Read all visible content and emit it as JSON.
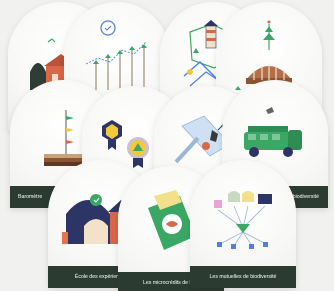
{
  "cards": {
    "row1_a": {
      "label": ""
    },
    "row1_b": {
      "label": ""
    },
    "row1_c": {
      "label": ""
    },
    "row1_d": {
      "label": ""
    },
    "row2_a": {
      "label": "Baromètre"
    },
    "row2_b": {
      "label": ""
    },
    "row2_c": {
      "label": ""
    },
    "row2_d": {
      "label": "biodiversité"
    },
    "row3_a": {
      "label": "École des expériences"
    },
    "row3_b": {
      "label": "Les microcrédits de la bi"
    },
    "row3_c": {
      "label": "Les mutuelles de biodiversité"
    }
  },
  "colors": {
    "bar": "#2c3b32",
    "green": "#3aa864",
    "orange": "#e8734a",
    "navy": "#2d3566",
    "yellow": "#f3c93a",
    "blue": "#4f7fe0"
  }
}
